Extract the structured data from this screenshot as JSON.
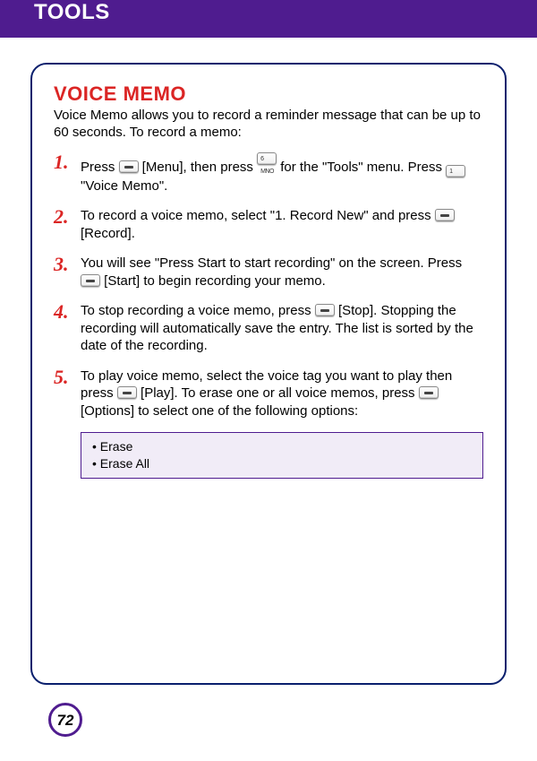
{
  "header": {
    "title": "TOOLS",
    "sub": ""
  },
  "section": {
    "title": "VOICE MEMO",
    "intro": "Voice Memo allows you to record a reminder message that can be up to 60 seconds.  To record a memo:"
  },
  "steps": {
    "s1a": "Press ",
    "s1b": " [Menu], then press ",
    "s1c": " for the \"Tools\" menu. Press ",
    "s1d": " \"Voice Memo\".",
    "s2a": "To record a voice memo, select \"1. Record New\" and press ",
    "s2b": " [Record].",
    "s3a": "You will see \"Press Start to start recording\" on the screen. Press ",
    "s3b": " [Start] to begin recording your memo.",
    "s4a": "To stop recording a voice memo, press ",
    "s4b": " [Stop].  Stopping the recording will automatically save the entry.  The list is sorted by the date of the recording.",
    "s5a": "To play voice memo, select the voice tag you want to play then press ",
    "s5b": " [Play].  To erase one or all voice memos, press ",
    "s5c": " [Options] to select one of the following options:"
  },
  "keys": {
    "six_label": "6 MNO",
    "one_label": "1"
  },
  "options": {
    "o1": "Erase",
    "o2": "Erase All"
  },
  "page": "72"
}
